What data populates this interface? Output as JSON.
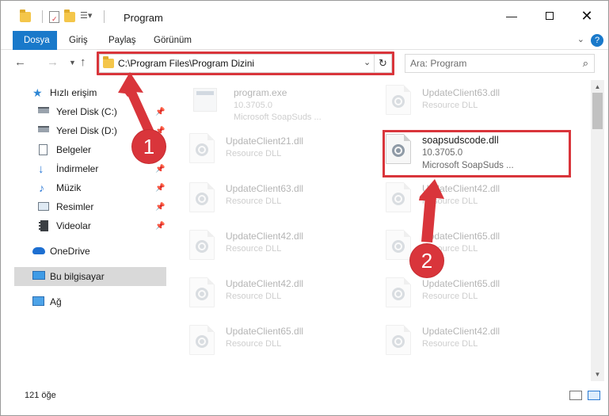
{
  "window": {
    "title": "Program"
  },
  "ribbon": {
    "tabs": [
      "Dosya",
      "Giriş",
      "Paylaş",
      "Görünüm"
    ]
  },
  "address": {
    "path": "C:\\Program Files\\Program Dizini"
  },
  "search": {
    "placeholder": "Ara: Program"
  },
  "nav": {
    "items": [
      {
        "label": "Hızlı erişim",
        "icon": "star-icon",
        "pinned": false
      },
      {
        "label": "Yerel Disk (C:)",
        "icon": "disk-icon",
        "pinned": true
      },
      {
        "label": "Yerel Disk (D:)",
        "icon": "disk-icon",
        "pinned": true
      },
      {
        "label": "Belgeler",
        "icon": "documents-icon",
        "pinned": true
      },
      {
        "label": "İndirmeler",
        "icon": "download-icon",
        "pinned": true
      },
      {
        "label": "Müzik",
        "icon": "music-icon",
        "pinned": true
      },
      {
        "label": "Resimler",
        "icon": "pictures-icon",
        "pinned": true
      },
      {
        "label": "Videolar",
        "icon": "videos-icon",
        "pinned": true
      },
      {
        "label": "OneDrive",
        "icon": "cloud-icon",
        "pinned": false
      },
      {
        "label": "Bu bilgisayar",
        "icon": "computer-icon",
        "pinned": false
      },
      {
        "label": "Ağ",
        "icon": "network-icon",
        "pinned": false
      }
    ]
  },
  "files": {
    "items": [
      {
        "name": "program.exe",
        "line2": "10.3705.0",
        "line3": "Microsoft SoapSuds ...",
        "kind": "exe",
        "faded": true
      },
      {
        "name": "UpdateClient63.dll",
        "line2": "Resource DLL",
        "kind": "dll",
        "faded": true
      },
      {
        "name": "UpdateClient21.dll",
        "line2": "Resource DLL",
        "kind": "dll",
        "faded": true
      },
      {
        "name": "soapsudscode.dll",
        "line2": "10.3705.0",
        "line3": "Microsoft SoapSuds ...",
        "kind": "dll",
        "faded": false
      },
      {
        "name": "UpdateClient63.dll",
        "line2": "Resource DLL",
        "kind": "dll",
        "faded": true
      },
      {
        "name": "UpdateClient42.dll",
        "line2": "Resource DLL",
        "kind": "dll",
        "faded": true
      },
      {
        "name": "UpdateClient42.dll",
        "line2": "Resource DLL",
        "kind": "dll",
        "faded": true
      },
      {
        "name": "UpdateClient65.dll",
        "line2": "Resource DLL",
        "kind": "dll",
        "faded": true
      },
      {
        "name": "UpdateClient42.dll",
        "line2": "Resource DLL",
        "kind": "dll",
        "faded": true
      },
      {
        "name": "UpdateClient65.dll",
        "line2": "Resource DLL",
        "kind": "dll",
        "faded": true
      },
      {
        "name": "UpdateClient65.dll",
        "line2": "Resource DLL",
        "kind": "dll",
        "faded": true
      },
      {
        "name": "UpdateClient42.dll",
        "line2": "Resource DLL",
        "kind": "dll",
        "faded": true
      }
    ]
  },
  "status": {
    "count": "121 öğe"
  },
  "annotations": {
    "step1": "1",
    "step2": "2",
    "color": "#d9353b"
  }
}
